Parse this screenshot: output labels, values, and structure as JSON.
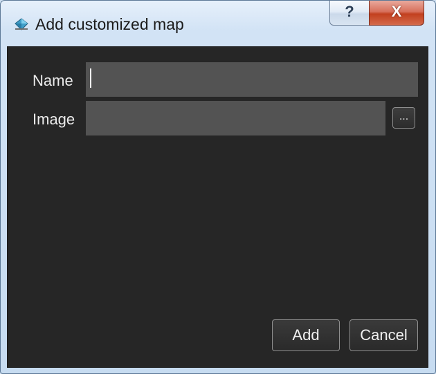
{
  "window": {
    "title": "Add customized map",
    "icon": "compass-gem-icon",
    "help_glyph": "?",
    "close_glyph": "X"
  },
  "form": {
    "name_label": "Name",
    "name_value": "",
    "image_label": "Image",
    "image_value": "",
    "browse_label": "..."
  },
  "actions": {
    "add_label": "Add",
    "cancel_label": "Cancel"
  },
  "colors": {
    "client_background": "#262626",
    "field_background": "#535353",
    "text": "#ececec"
  }
}
